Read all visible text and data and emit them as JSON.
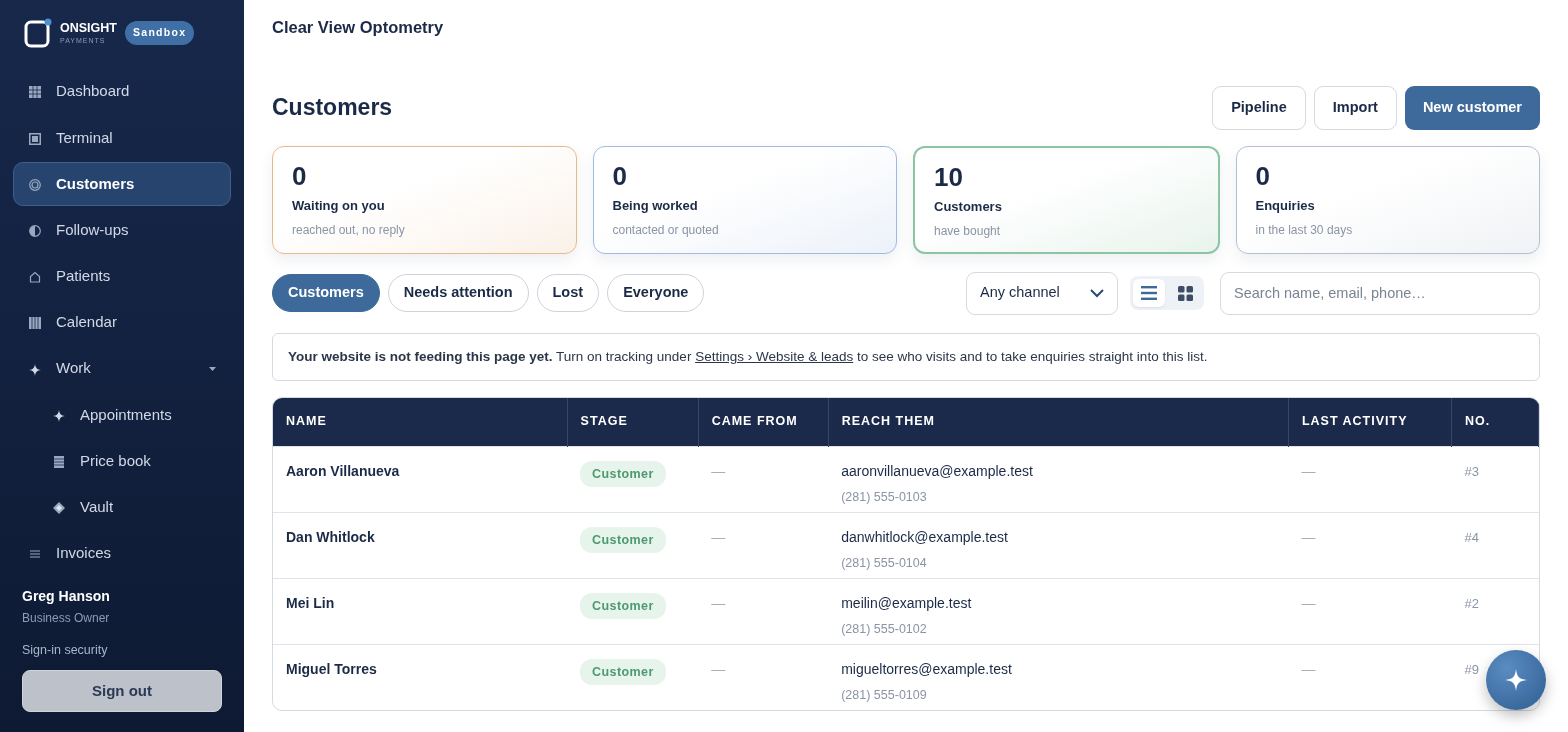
{
  "brand": {
    "name": "ONSIGHT",
    "tagline": "PAYMENTS",
    "badge": "Sandbox"
  },
  "sidebar": {
    "items": [
      {
        "label": "Dashboard",
        "selected": false
      },
      {
        "label": "Terminal",
        "selected": false
      },
      {
        "label": "Customers",
        "selected": true
      },
      {
        "label": "Follow-ups",
        "selected": false
      },
      {
        "label": "Patients",
        "selected": false
      },
      {
        "label": "Calendar",
        "selected": false
      },
      {
        "label": "Work",
        "selected": false,
        "expanded": true,
        "children": [
          {
            "label": "Appointments",
            "selected": false
          },
          {
            "label": "Price book",
            "selected": false
          },
          {
            "label": "Vault",
            "selected": false
          }
        ]
      },
      {
        "label": "Invoices",
        "selected": false
      }
    ],
    "user": {
      "name": "Greg Hanson",
      "role": "Business Owner"
    },
    "security_link": "Sign-in security",
    "sign_out": "Sign out"
  },
  "header": {
    "title": "Clear View Optometry"
  },
  "page": {
    "title": "Customers",
    "buttons": [
      {
        "label": "Pipeline",
        "kind": "outline"
      },
      {
        "label": "Import",
        "kind": "outline"
      },
      {
        "label": "New customer",
        "kind": "primary"
      }
    ]
  },
  "stats": [
    {
      "value": "0",
      "label": "Waiting on you",
      "note": "reached out, no reply",
      "color": "#e8b98a",
      "selected": false
    },
    {
      "value": "0",
      "label": "Being worked",
      "note": "contacted or quoted",
      "color": "#9fbbe0",
      "selected": false
    },
    {
      "value": "10",
      "label": "Customers",
      "note": "have bought",
      "color": "#8cc4a4",
      "selected": true
    },
    {
      "value": "0",
      "label": "Enquiries",
      "note": "in the last 30 days",
      "color": "#b5bfd0",
      "selected": false
    }
  ],
  "filters": [
    {
      "label": "Customers",
      "selected": true
    },
    {
      "label": "Needs attention",
      "selected": false
    },
    {
      "label": "Lost",
      "selected": false
    },
    {
      "label": "Everyone",
      "selected": false
    }
  ],
  "channel": {
    "value": "Any channel"
  },
  "views": [
    {
      "kind": "list",
      "selected": true
    },
    {
      "kind": "grid",
      "selected": false
    }
  ],
  "search": {
    "placeholder": "Search name, email, phone…"
  },
  "notice": {
    "text": "**Your website is not feeding this page yet.** Turn on tracking under",
    "link": "Settings › Website & leads",
    "after": "to see who visits and to take enquiries straight into this list."
  },
  "table": {
    "columns": [
      "NAME",
      "STAGE",
      "CAME FROM",
      "REACH THEM",
      "LAST ACTIVITY",
      "NO."
    ],
    "rows": [
      {
        "name": "Aaron Villanueva",
        "stage": "Customer",
        "came_from": "—",
        "email": "aaronvillanueva@example.test",
        "phone": "(281) 555-0103",
        "last_activity": "—",
        "number": "#3"
      },
      {
        "name": "Dan Whitlock",
        "stage": "Customer",
        "came_from": "—",
        "email": "danwhitlock@example.test",
        "phone": "(281) 555-0104",
        "last_activity": "—",
        "number": "#4"
      },
      {
        "name": "Mei Lin",
        "stage": "Customer",
        "came_from": "—",
        "email": "meilin@example.test",
        "phone": "(281) 555-0102",
        "last_activity": "—",
        "number": "#2"
      },
      {
        "name": "Miguel Torres",
        "stage": "Customer",
        "came_from": "—",
        "email": "migueltorres@example.test",
        "phone": "(281) 555-0109",
        "last_activity": "—",
        "number": "#9"
      }
    ]
  }
}
